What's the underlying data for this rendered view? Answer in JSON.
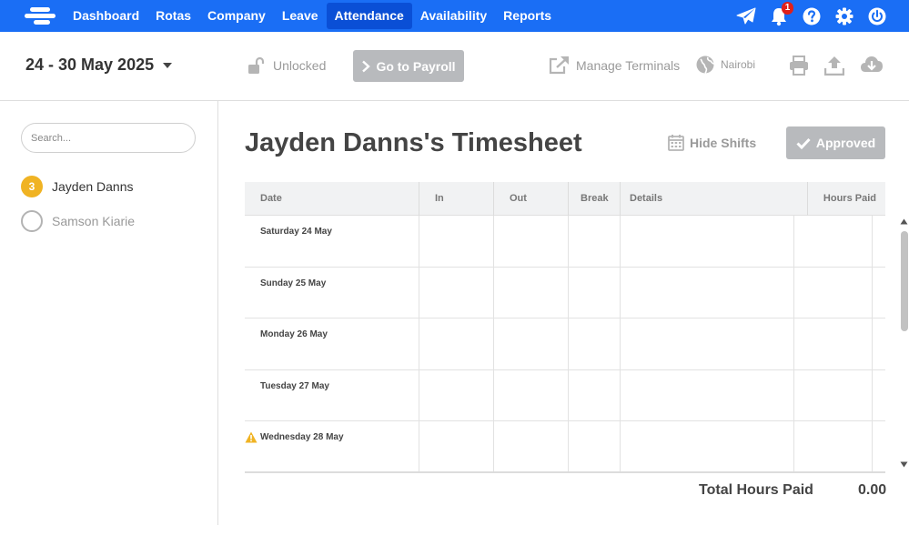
{
  "nav": {
    "items": [
      {
        "label": "Dashboard",
        "active": false
      },
      {
        "label": "Rotas",
        "active": false
      },
      {
        "label": "Company",
        "active": false
      },
      {
        "label": "Leave",
        "active": false
      },
      {
        "label": "Attendance",
        "active": true
      },
      {
        "label": "Availability",
        "active": false
      },
      {
        "label": "Reports",
        "active": false
      }
    ],
    "notification_count": "1",
    "accent": "#1a6ef5",
    "active_bg": "#0a4fd6"
  },
  "toolbar": {
    "date_range": "24 - 30 May 2025",
    "lock_status": "Unlocked",
    "payroll_label": "Go to Payroll",
    "terminals_label": "Manage Terminals",
    "location_label": "Nairobi"
  },
  "sidebar": {
    "search_placeholder": "Search...",
    "employees": [
      {
        "name": "Jayden Danns",
        "badge": "3",
        "selected": true,
        "badge_color": "#f0b323"
      },
      {
        "name": "Samson Kiarie",
        "badge": "",
        "selected": false
      }
    ]
  },
  "main": {
    "title": "Jayden Danns's Timesheet",
    "hide_shifts_label": "Hide Shifts",
    "approved_label": "Approved",
    "columns": [
      "Date",
      "In",
      "Out",
      "Break",
      "Details",
      "Hours Paid"
    ],
    "rows": [
      {
        "date": "Saturday 24 May",
        "warning": false
      },
      {
        "date": "Sunday 25 May",
        "warning": false
      },
      {
        "date": "Monday 26 May",
        "warning": false
      },
      {
        "date": "Tuesday 27 May",
        "warning": false
      },
      {
        "date": "Wednesday 28 May",
        "warning": true
      }
    ],
    "total_label": "Total Hours Paid",
    "total_value": "0.00"
  }
}
